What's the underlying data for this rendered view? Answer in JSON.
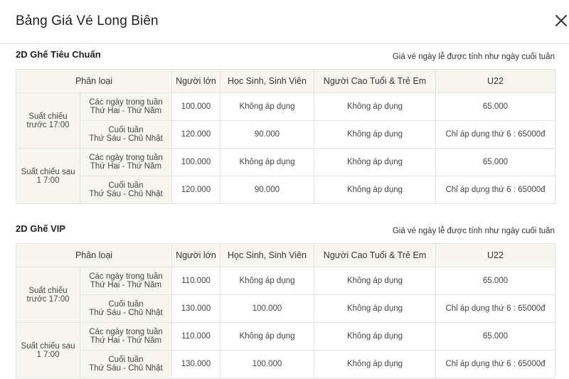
{
  "modal": {
    "title": "Bảng Giá Vé Long Biên",
    "close_icon": "close-icon"
  },
  "sections": [
    {
      "title": "2D Ghế Tiêu Chuẩn",
      "note": "Giá vé ngày lễ được tính như ngày cuối tuần",
      "headers": [
        "Phân loại",
        "Người lớn",
        "Học Sinh, Sinh Viên",
        "Người Cao Tuổi & Trẻ Em",
        "U22"
      ],
      "groups": [
        {
          "showtime": "Suất chiếu trước 17:00",
          "rows": [
            {
              "day_line1": "Các ngày trong tuần",
              "day_line2": "Thứ Hai - Thứ Năm",
              "adult": "100.000",
              "student": "Không áp dụng",
              "senior_child": "Không áp dụng",
              "u22": "65.000"
            },
            {
              "day_line1": "Cuối tuần",
              "day_line2": "Thứ Sáu - Chủ Nhật",
              "adult": "120.000",
              "student": "90.000",
              "senior_child": "Không áp dụng",
              "u22": "Chỉ áp dụng thứ 6 : 65000đ"
            }
          ]
        },
        {
          "showtime": "Suất chiếu sau 1 7:00",
          "rows": [
            {
              "day_line1": "Các ngày trong tuần",
              "day_line2": "Thứ Hai - Thứ Năm",
              "adult": "100.000",
              "student": "Không áp dụng",
              "senior_child": "Không áp dụng",
              "u22": "65.000"
            },
            {
              "day_line1": "Cuối tuần",
              "day_line2": "Thứ Sáu - Chủ Nhật",
              "adult": "120.000",
              "student": "90.000",
              "senior_child": "Không áp dụng",
              "u22": "Chỉ áp dụng thứ 6 : 65000đ"
            }
          ]
        }
      ]
    },
    {
      "title": "2D Ghế VIP",
      "note": "Giá vé ngày lễ được tính như ngày cuối tuần",
      "headers": [
        "Phân loại",
        "Người lớn",
        "Học Sinh, Sinh Viên",
        "Người Cao Tuổi & Trẻ Em",
        "U22"
      ],
      "groups": [
        {
          "showtime": "Suất chiếu trước 17:00",
          "rows": [
            {
              "day_line1": "Các ngày trong tuần",
              "day_line2": "Thứ Hai - Thứ Năm",
              "adult": "110.000",
              "student": "Không áp dụng",
              "senior_child": "Không áp dụng",
              "u22": "65.000"
            },
            {
              "day_line1": "Cuối tuần",
              "day_line2": "Thứ Sáu - Chủ Nhật",
              "adult": "130.000",
              "student": "100.000",
              "senior_child": "Không áp dụng",
              "u22": "Chỉ áp dụng thứ 6 : 65000đ"
            }
          ]
        },
        {
          "showtime": "Suất chiếu sau 1 7:00",
          "rows": [
            {
              "day_line1": "Các ngày trong tuần",
              "day_line2": "Thứ Hai - Thứ Năm",
              "adult": "110.000",
              "student": "Không áp dụng",
              "senior_child": "Không áp dụng",
              "u22": "65.000"
            },
            {
              "day_line1": "Cuối tuần",
              "day_line2": "Thứ Sáu - Chủ Nhật",
              "adult": "130.000",
              "student": "100.000",
              "senior_child": "Không áp dụng",
              "u22": "Chỉ áp dụng thứ 6 : 65000đ"
            }
          ]
        }
      ]
    }
  ]
}
